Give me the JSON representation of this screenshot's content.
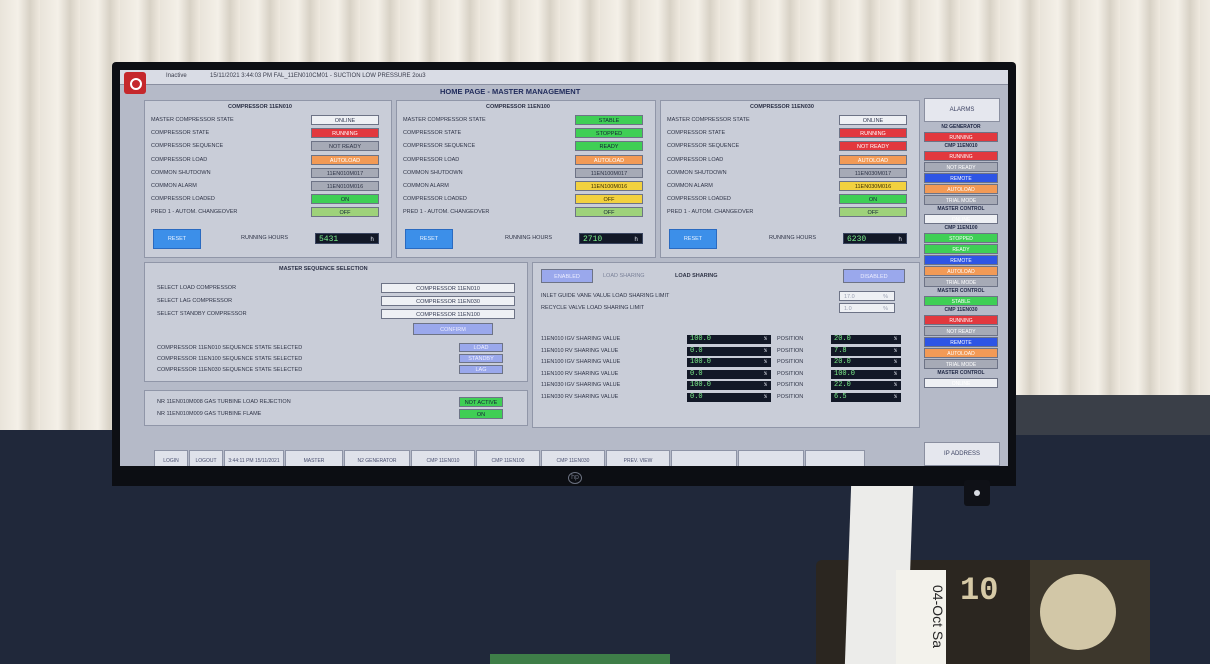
{
  "window": {
    "status": "Inactive",
    "alarm_line": "15/11/2021 3:44:03 PM  FAL_11EN010CM01 - SUCTION LOW PRESSURE 2ou3",
    "title": "HOME PAGE - MASTER MANAGEMENT"
  },
  "compressors": [
    {
      "title": "COMPRESSOR 11EN010",
      "rows": [
        {
          "label": "MASTER COMPRESSOR STATE",
          "value": "ONLINE",
          "color": "white"
        },
        {
          "label": "COMPRESSOR STATE",
          "value": "RUNNING",
          "color": "red"
        },
        {
          "label": "COMPRESSOR SEQUENCE",
          "value": "NOT READY",
          "color": "gray"
        },
        {
          "label": "COMPRESSOR LOAD",
          "value": "AUTOLOAD",
          "color": "orange"
        },
        {
          "label": "COMMON SHUTDOWN",
          "value": "11EN010M017",
          "color": "gray"
        },
        {
          "label": "COMMON ALARM",
          "value": "11EN010M016",
          "color": "gray"
        },
        {
          "label": "COMPRESSOR LOADED",
          "value": "ON",
          "color": "green"
        },
        {
          "label": "PRED 1 - AUTOM. CHANGEOVER",
          "value": "OFF",
          "color": "lgreen"
        }
      ],
      "reset": "RESET",
      "hours_label": "RUNNING HOURS",
      "hours": "5431",
      "hours_unit": "h"
    },
    {
      "title": "COMPRESSOR 11EN100",
      "rows": [
        {
          "label": "MASTER COMPRESSOR STATE",
          "value": "STABLE",
          "color": "green"
        },
        {
          "label": "COMPRESSOR STATE",
          "value": "STOPPED",
          "color": "green"
        },
        {
          "label": "COMPRESSOR SEQUENCE",
          "value": "READY",
          "color": "green"
        },
        {
          "label": "COMPRESSOR LOAD",
          "value": "AUTOLOAD",
          "color": "orange"
        },
        {
          "label": "COMMON SHUTDOWN",
          "value": "11EN100M017",
          "color": "gray"
        },
        {
          "label": "COMMON ALARM",
          "value": "11EN100M016",
          "color": "yellow"
        },
        {
          "label": "COMPRESSOR LOADED",
          "value": "OFF",
          "color": "yellow"
        },
        {
          "label": "PRED 1 - AUTOM. CHANGEOVER",
          "value": "OFF",
          "color": "lgreen"
        }
      ],
      "reset": "RESET",
      "hours_label": "RUNNING HOURS",
      "hours": "2710",
      "hours_unit": "h"
    },
    {
      "title": "COMPRESSOR 11EN030",
      "rows": [
        {
          "label": "MASTER COMPRESSOR STATE",
          "value": "ONLINE",
          "color": "white"
        },
        {
          "label": "COMPRESSOR STATE",
          "value": "RUNNING",
          "color": "red"
        },
        {
          "label": "COMPRESSOR SEQUENCE",
          "value": "NOT READY",
          "color": "red"
        },
        {
          "label": "COMPRESSOR LOAD",
          "value": "AUTOLOAD",
          "color": "orange"
        },
        {
          "label": "COMMON SHUTDOWN",
          "value": "11EN030M017",
          "color": "gray"
        },
        {
          "label": "COMMON ALARM",
          "value": "11EN030M016",
          "color": "yellow"
        },
        {
          "label": "COMPRESSOR LOADED",
          "value": "ON",
          "color": "green"
        },
        {
          "label": "PRED 1 - AUTOM. CHANGEOVER",
          "value": "OFF",
          "color": "lgreen"
        }
      ],
      "reset": "RESET",
      "hours_label": "RUNNING HOURS",
      "hours": "6230",
      "hours_unit": "h"
    }
  ],
  "sequence": {
    "title": "MASTER SEQUENCE SELECTION",
    "selects": [
      {
        "label": "SELECT LOAD COMPRESSOR",
        "value": "COMPRESSOR 11EN010"
      },
      {
        "label": "SELECT LAG COMPRESSOR",
        "value": "COMPRESSOR 11EN030"
      },
      {
        "label": "SELECT STANDBY COMPRESSOR",
        "value": "COMPRESSOR 11EN100"
      }
    ],
    "confirm": "CONFIRM",
    "states": [
      {
        "label": "COMPRESSOR 11EN010 SEQUENCE STATE SELECTED",
        "value": "LOAD"
      },
      {
        "label": "COMPRESSOR 11EN100 SEQUENCE STATE SELECTED",
        "value": "STANDBY"
      },
      {
        "label": "COMPRESSOR 11EN030 SEQUENCE STATE SELECTED",
        "value": "LAG"
      }
    ],
    "gas_rows": [
      {
        "label": "NR 11EN010M008   GAS TURBINE LOAD REJECTION",
        "value": "NOT ACTIVE"
      },
      {
        "label": "NR 11EN010M009   GAS TURBINE FLAME",
        "value": "ON"
      }
    ]
  },
  "load_sharing": {
    "toggle_on": "LOAD SHARING",
    "toggle_off": "LOAD SHARING",
    "button_left": "ENABLED",
    "button_right": "DISABLED",
    "limit_rows": [
      {
        "label": "INLET GUIDE VANE VALUE LOAD SHARING LIMIT",
        "value": "17.0",
        "unit": "%"
      },
      {
        "label": "RECYCLE VALVE LOAD SHARING LIMIT",
        "value": "1.0",
        "unit": "%"
      }
    ],
    "values": [
      {
        "label": "11EN010 IGV SHARING VALUE",
        "value": "100.0",
        "unit": "%",
        "pos_label": "POSITION",
        "pos": "20.0"
      },
      {
        "label": "11EN010 RV SHARING VALUE",
        "value": "0.0",
        "unit": "%",
        "pos_label": "POSITION",
        "pos": "7.8"
      },
      {
        "label": "11EN100 IGV SHARING VALUE",
        "value": "100.0",
        "unit": "%",
        "pos_label": "POSITION",
        "pos": "20.0"
      },
      {
        "label": "11EN100 RV SHARING VALUE",
        "value": "0.0",
        "unit": "%",
        "pos_label": "POSITION",
        "pos": "100.0"
      },
      {
        "label": "11EN030 IGV SHARING VALUE",
        "value": "100.0",
        "unit": "%",
        "pos_label": "POSITION",
        "pos": "22.0"
      },
      {
        "label": "11EN030 RV SHARING VALUE",
        "value": "0.0",
        "unit": "%",
        "pos_label": "POSITION",
        "pos": "6.5"
      }
    ]
  },
  "sidebar": {
    "alarms": "ALARMS",
    "items": [
      {
        "type": "head",
        "text": "N2 GENERATOR"
      },
      {
        "type": "box",
        "text": "RUNNING",
        "color": "red"
      },
      {
        "type": "head",
        "text": "CMP 11EN010"
      },
      {
        "type": "box",
        "text": "RUNNING",
        "color": "red"
      },
      {
        "type": "box",
        "text": "NOT READY",
        "color": "gray"
      },
      {
        "type": "box",
        "text": "REMOTE",
        "color": "blue"
      },
      {
        "type": "box",
        "text": "AUTOLOAD",
        "color": "orange"
      },
      {
        "type": "box",
        "text": "TRIAL MODE",
        "color": "gray"
      },
      {
        "type": "head",
        "text": "MASTER CONTROL"
      },
      {
        "type": "box",
        "text": "ONLINE",
        "color": "white"
      },
      {
        "type": "head",
        "text": "CMP 11EN100"
      },
      {
        "type": "box",
        "text": "STOPPED",
        "color": "green"
      },
      {
        "type": "box",
        "text": "READY",
        "color": "green"
      },
      {
        "type": "box",
        "text": "REMOTE",
        "color": "blue"
      },
      {
        "type": "box",
        "text": "AUTOLOAD",
        "color": "orange"
      },
      {
        "type": "box",
        "text": "TRIAL MODE",
        "color": "gray"
      },
      {
        "type": "head",
        "text": "MASTER CONTROL"
      },
      {
        "type": "box",
        "text": "STABLE",
        "color": "green"
      },
      {
        "type": "head",
        "text": "CMP 11EN030"
      },
      {
        "type": "box",
        "text": "RUNNING",
        "color": "red"
      },
      {
        "type": "box",
        "text": "NOT READY",
        "color": "gray"
      },
      {
        "type": "box",
        "text": "REMOTE",
        "color": "blue"
      },
      {
        "type": "box",
        "text": "AUTOLOAD",
        "color": "orange"
      },
      {
        "type": "box",
        "text": "TRIAL MODE",
        "color": "gray"
      },
      {
        "type": "head",
        "text": "MASTER CONTROL"
      },
      {
        "type": "box",
        "text": "ONLINE",
        "color": "white"
      }
    ],
    "ip_address": "IP ADDRESS"
  },
  "nav": {
    "buttons": [
      "LOGIN",
      "LOGOUT",
      "3:44:11 PM 15/11/2021",
      "MASTER",
      "N2 GENERATOR",
      "CMP 11EN010",
      "CMP 11EN100",
      "CMP 11EN030",
      "PREV. VIEW",
      "",
      "",
      ""
    ]
  },
  "desk": {
    "paper_text": "04-Oct Sa",
    "number": "10"
  }
}
